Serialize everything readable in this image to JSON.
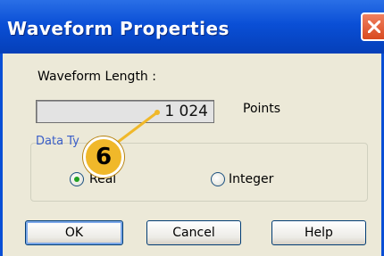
{
  "window": {
    "title": "Waveform Properties"
  },
  "form": {
    "length_label": "Waveform Length :",
    "length_value": "1 024",
    "length_unit": "Points",
    "group_label": "Data Ty",
    "radio_real_label": "Real",
    "radio_integer_label": "Integer",
    "selected": "Real"
  },
  "buttons": {
    "ok": "OK",
    "cancel": "Cancel",
    "help": "Help"
  },
  "callout": {
    "number": "6"
  },
  "colors": {
    "titlebar": "#0a4fd6",
    "callout": "#f0b82a",
    "radio_selected": "#21a121"
  }
}
